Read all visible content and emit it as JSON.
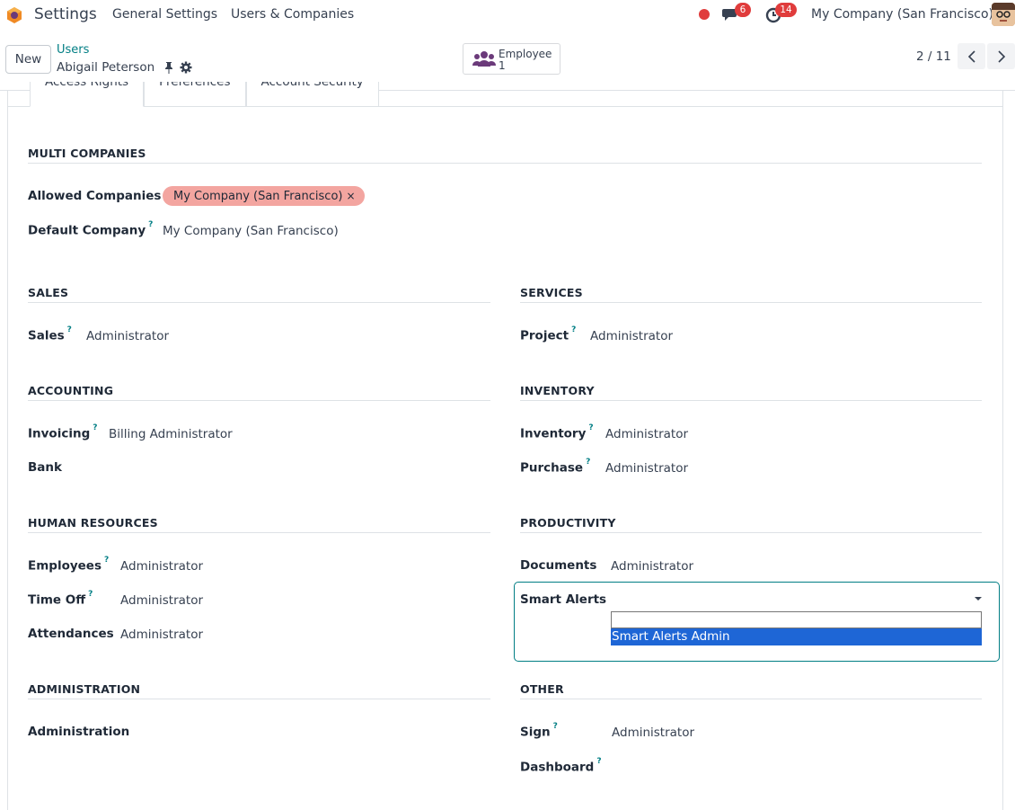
{
  "topnav": {
    "app_title": "Settings",
    "menu": [
      "General Settings",
      "Users & Companies"
    ],
    "messages_count": "6",
    "activities_count": "14",
    "company": "My Company (San Francisco)",
    "icons": [
      "app-logo-icon",
      "status-dot-icon",
      "chat-icon",
      "clock-icon",
      "user-avatar"
    ]
  },
  "controlpanel": {
    "new_label": "New",
    "breadcrumb_parent": "Users",
    "breadcrumb_current": "Abigail Peterson",
    "smart_button": {
      "label": "Employee",
      "value": "1"
    },
    "pager": "2 / 11"
  },
  "tabs": [
    "Access Rights",
    "Preferences",
    "Account Security"
  ],
  "multi_companies": {
    "title": "MULTI COMPANIES",
    "allowed_label": "Allowed Companies",
    "allowed_tag": "My Company (San Francisco)",
    "tag_remove": "×",
    "default_label": "Default Company",
    "default_value": "My Company (San Francisco)"
  },
  "help_mark": "?",
  "sales": {
    "title": "SALES",
    "label": "Sales",
    "value": "Administrator"
  },
  "services": {
    "title": "SERVICES",
    "label": "Project",
    "value": "Administrator"
  },
  "accounting": {
    "title": "ACCOUNTING",
    "invoicing_label": "Invoicing",
    "invoicing_value": "Billing Administrator",
    "bank_label": "Bank"
  },
  "inventory": {
    "title": "INVENTORY",
    "inventory_label": "Inventory",
    "inventory_value": "Administrator",
    "purchase_label": "Purchase",
    "purchase_value": "Administrator"
  },
  "human_resources": {
    "title": "HUMAN RESOURCES",
    "employees_label": "Employees",
    "employees_value": "Administrator",
    "timeoff_label": "Time Off",
    "timeoff_value": "Administrator",
    "attendances_label": "Attendances",
    "attendances_value": "Administrator"
  },
  "productivity": {
    "title": "PRODUCTIVITY",
    "documents_label": "Documents",
    "documents_value": "Administrator",
    "smart_alerts_label": "Smart Alerts",
    "smart_alerts_option": "Smart Alerts Admin"
  },
  "administration": {
    "title": "ADMINISTRATION",
    "label": "Administration"
  },
  "other": {
    "title": "OTHER",
    "sign_label": "Sign",
    "sign_value": "Administrator",
    "dashboard_label": "Dashboard"
  },
  "colors": {
    "accent": "#017e84",
    "tag": "#f3a5a0",
    "badge": "#e03c3c",
    "selection": "#1e66d6"
  }
}
